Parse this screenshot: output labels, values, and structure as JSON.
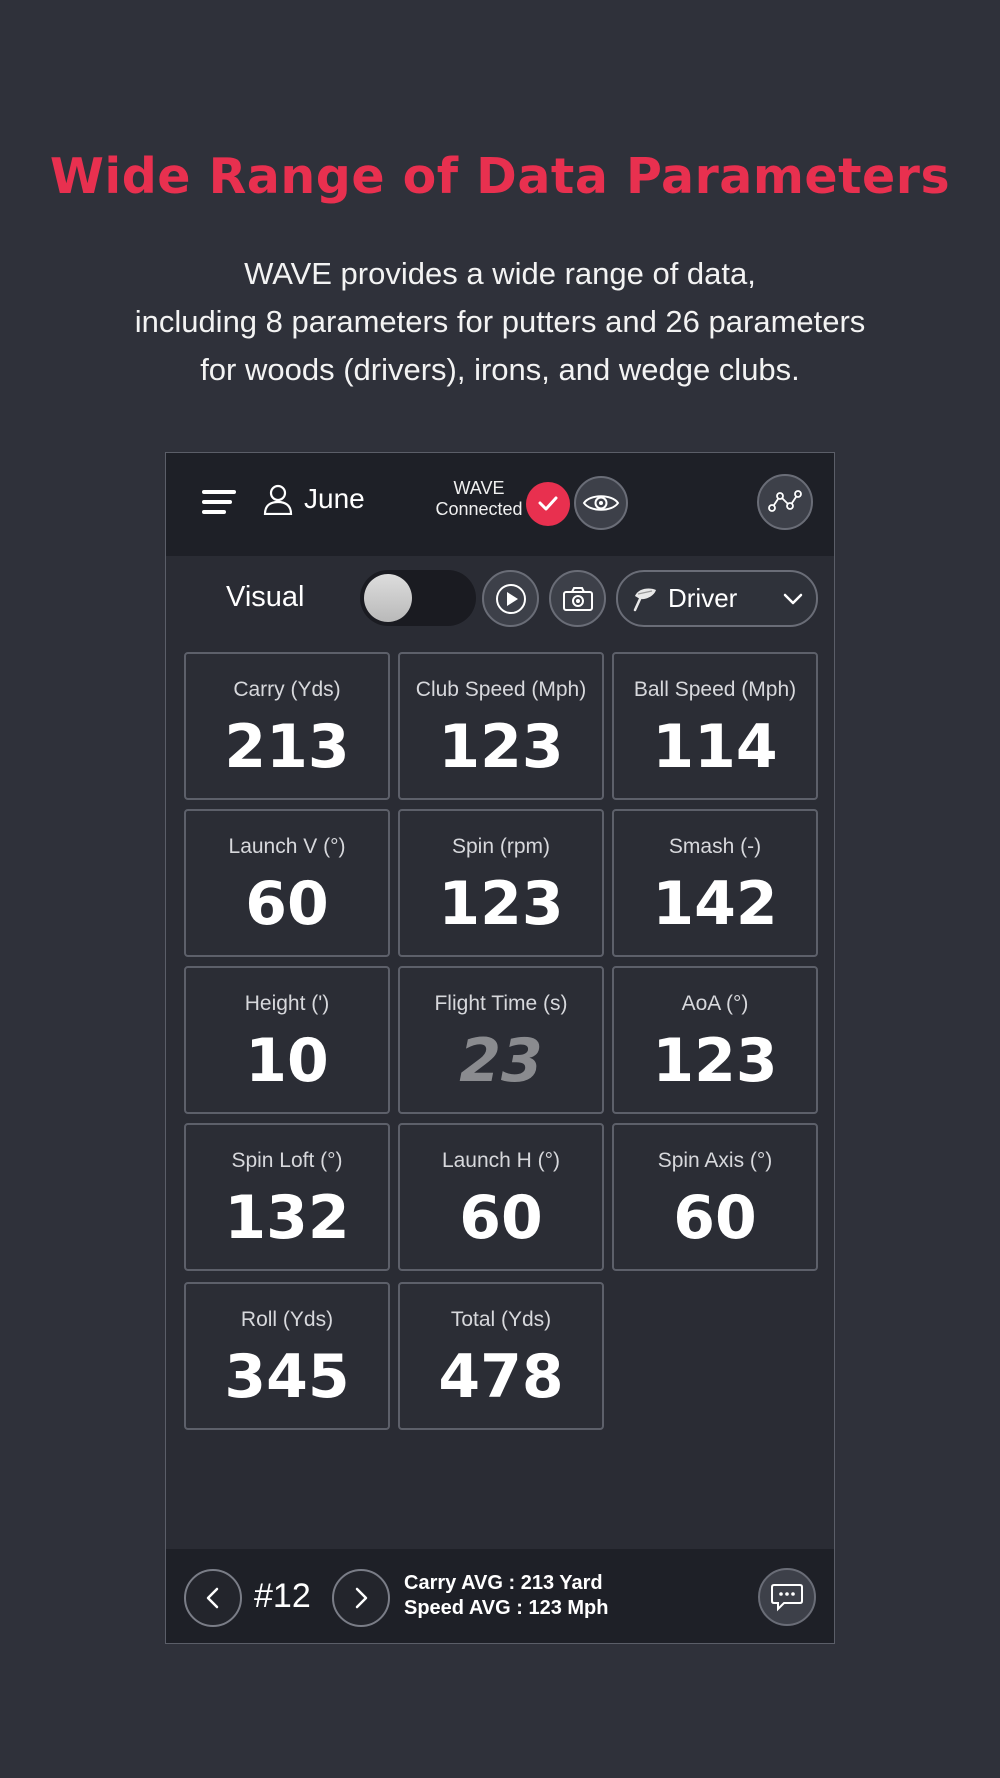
{
  "headline": "Wide Range of Data Parameters",
  "subtitle_lines": [
    "WAVE provides a wide range of data,",
    "including 8 parameters for putters and  26 parameters",
    "for woods (drivers), irons, and wedge clubs."
  ],
  "app": {
    "header": {
      "user_name": "June",
      "device_line1": "WAVE",
      "device_line2": "Connected"
    },
    "controls": {
      "visual_label": "Visual",
      "visual_toggle_on": false,
      "club_selected": "Driver"
    },
    "tiles": [
      {
        "label": "Carry (Yds)",
        "value": "213"
      },
      {
        "label": "Club Speed (Mph)",
        "value": "123"
      },
      {
        "label": "Ball Speed (Mph)",
        "value": "114"
      },
      {
        "label": "Launch V (°)",
        "value": "60"
      },
      {
        "label": "Spin (rpm)",
        "value": "123"
      },
      {
        "label": "Smash (-)",
        "value": "142"
      },
      {
        "label": "Height (')",
        "value": "10"
      },
      {
        "label": "Flight Time (s)",
        "value": "23"
      },
      {
        "label": "AoA (°)",
        "value": "123"
      },
      {
        "label": "Spin Loft (°)",
        "value": "132"
      },
      {
        "label": "Launch H (°)",
        "value": "60"
      },
      {
        "label": "Spin Axis (°)",
        "value": "60"
      },
      {
        "label": "Roll (Yds)",
        "value": "345"
      },
      {
        "label": "Total (Yds)",
        "value": "478"
      }
    ],
    "footer": {
      "shot_number": "#12",
      "carry_avg": "Carry AVG : 213 Yard",
      "speed_avg": "Speed AVG : 123 Mph"
    }
  },
  "colors": {
    "accent": "#e8304f",
    "background": "#2f313a",
    "bar": "#1e2027"
  },
  "icons": [
    "menu-icon",
    "user-icon",
    "check-icon",
    "eye-icon",
    "share-nodes-icon",
    "play-icon",
    "camera-icon",
    "driver-club-icon",
    "chevron-down-icon",
    "chevron-left-icon",
    "chevron-right-icon",
    "chat-icon"
  ]
}
